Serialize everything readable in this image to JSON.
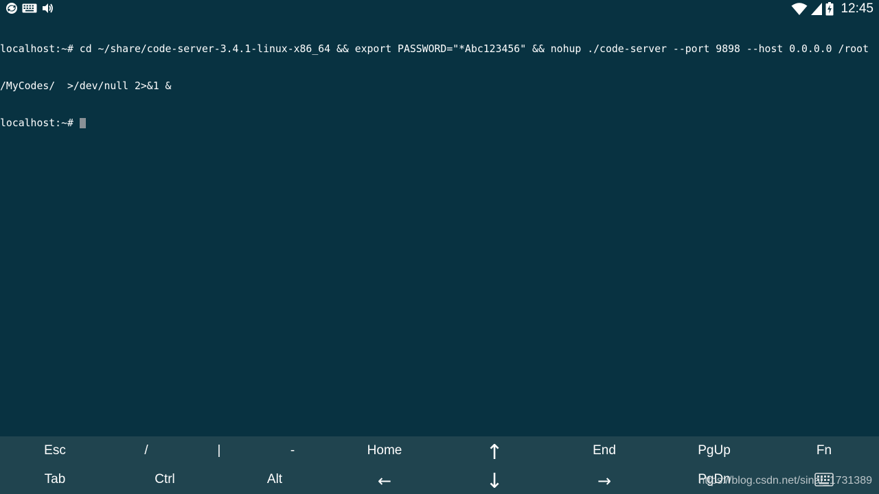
{
  "status_bar": {
    "time": "12:45",
    "left_icons": [
      "sync-icon",
      "keyboard-icon",
      "volume-icon"
    ],
    "right_icons": [
      "wifi-icon",
      "signal-icon",
      "battery-icon"
    ]
  },
  "terminal": {
    "lines": [
      "localhost:~# cd ~/share/code-server-3.4.1-linux-x86_64 && export PASSWORD=\"*Abc123456\" && nohup ./code-server --port 9898 --host 0.0.0.0 /root",
      "/MyCodes/  >/dev/null 2>&1 &",
      "localhost:~# "
    ]
  },
  "extra_keys": {
    "row1": [
      "Esc",
      "/",
      "|",
      "-",
      "Home",
      "↑",
      "End",
      "PgUp",
      "Fn"
    ],
    "row2": [
      "Tab",
      "Ctrl",
      "Alt",
      "←",
      "↓",
      "→",
      "PgDn"
    ]
  },
  "watermark": "https://blog.csdn.net/sinat_1731389",
  "colors": {
    "terminal_background": "#083241",
    "extra_keys_background": "#20444f",
    "text": "#ffffff",
    "cursor": "#8a9196"
  }
}
